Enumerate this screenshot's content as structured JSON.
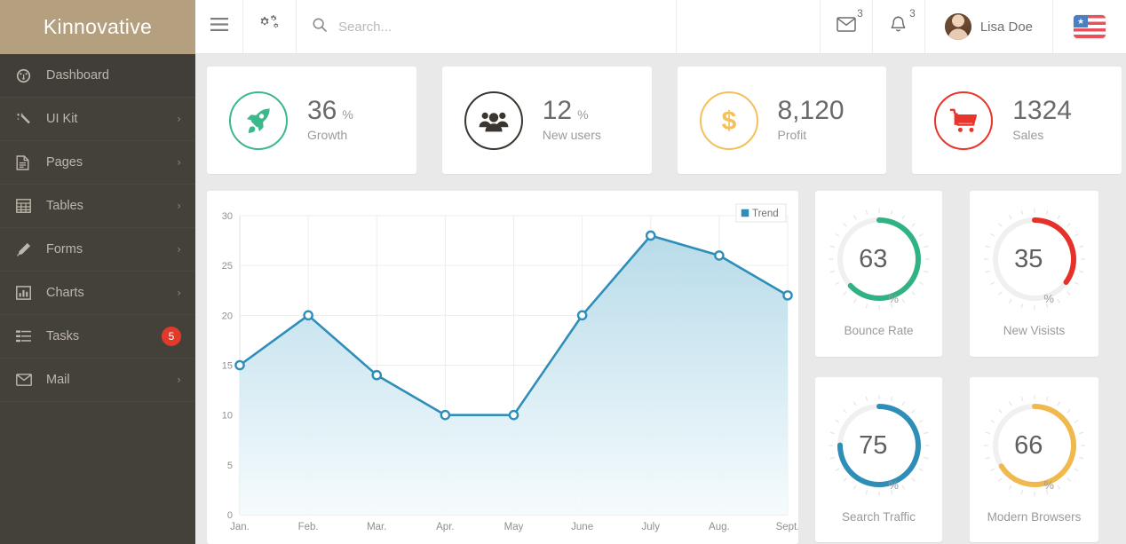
{
  "brand": {
    "name": "Kinnovative"
  },
  "sidebar": {
    "items": [
      {
        "label": "Dashboard",
        "icon": "dashboard-icon",
        "active": true,
        "chevron": false,
        "badge": null
      },
      {
        "label": "UI Kit",
        "icon": "magic-wand-icon",
        "active": false,
        "chevron": true,
        "badge": null
      },
      {
        "label": "Pages",
        "icon": "file-icon",
        "active": false,
        "chevron": true,
        "badge": null
      },
      {
        "label": "Tables",
        "icon": "table-icon",
        "active": false,
        "chevron": true,
        "badge": null
      },
      {
        "label": "Forms",
        "icon": "pencil-icon",
        "active": false,
        "chevron": true,
        "badge": null
      },
      {
        "label": "Charts",
        "icon": "bar-chart-icon",
        "active": false,
        "chevron": true,
        "badge": null
      },
      {
        "label": "Tasks",
        "icon": "tasks-icon",
        "active": false,
        "chevron": false,
        "badge": "5"
      },
      {
        "label": "Mail",
        "icon": "envelope-icon",
        "active": false,
        "chevron": true,
        "badge": null
      }
    ]
  },
  "topbar": {
    "menu_toggle": "hamburger-icon",
    "settings": "cogs-icon",
    "search": {
      "placeholder": "Search...",
      "value": "",
      "icon": "search-icon"
    },
    "messages": {
      "icon": "envelope-icon",
      "count": "3"
    },
    "notifications": {
      "icon": "bell-icon",
      "count": "3"
    },
    "user": {
      "name": "Lisa Doe",
      "avatar": "user-avatar"
    },
    "language": {
      "icon": "us-flag-icon",
      "star": "★"
    }
  },
  "stats": [
    {
      "value": "36",
      "unit": "%",
      "label": "Growth",
      "icon": "rocket-icon",
      "color": "#3cb98b"
    },
    {
      "value": "12",
      "unit": "%",
      "label": "New users",
      "icon": "users-icon",
      "color": "#3a352f"
    },
    {
      "value": "8,120",
      "unit": "",
      "label": "Profit",
      "icon": "dollar-icon",
      "color": "#f4c05a"
    },
    {
      "value": "1324",
      "unit": "",
      "label": "Sales",
      "icon": "cart-icon",
      "color": "#e8342a"
    }
  ],
  "chart_data": {
    "type": "area",
    "title": "",
    "xlabel": "",
    "ylabel": "",
    "categories": [
      "Jan.",
      "Feb.",
      "Mar.",
      "Apr.",
      "May",
      "June",
      "July",
      "Aug.",
      "Sept."
    ],
    "series": [
      {
        "name": "Trend",
        "color": "#2e8eb8",
        "values": [
          15,
          20,
          14,
          10,
          10,
          20,
          28,
          26,
          22
        ]
      }
    ],
    "yticks": [
      "0",
      "5",
      "10",
      "15",
      "20",
      "25",
      "30"
    ],
    "ylim": [
      0,
      30
    ],
    "grid": true,
    "legend": {
      "position": "top-right",
      "entries": [
        "Trend"
      ]
    }
  },
  "gauges": [
    {
      "value": "63",
      "unit": "%",
      "label": "Bounce Rate",
      "color": "#2fb383",
      "percent": 63
    },
    {
      "value": "35",
      "unit": "%",
      "label": "New Visists",
      "color": "#e53129",
      "percent": 35
    },
    {
      "value": "75",
      "unit": "%",
      "label": "Search Traffic",
      "color": "#2e8eb8",
      "percent": 75
    },
    {
      "value": "66",
      "unit": "%",
      "label": "Modern Browsers",
      "color": "#f0b94e",
      "percent": 66
    }
  ]
}
